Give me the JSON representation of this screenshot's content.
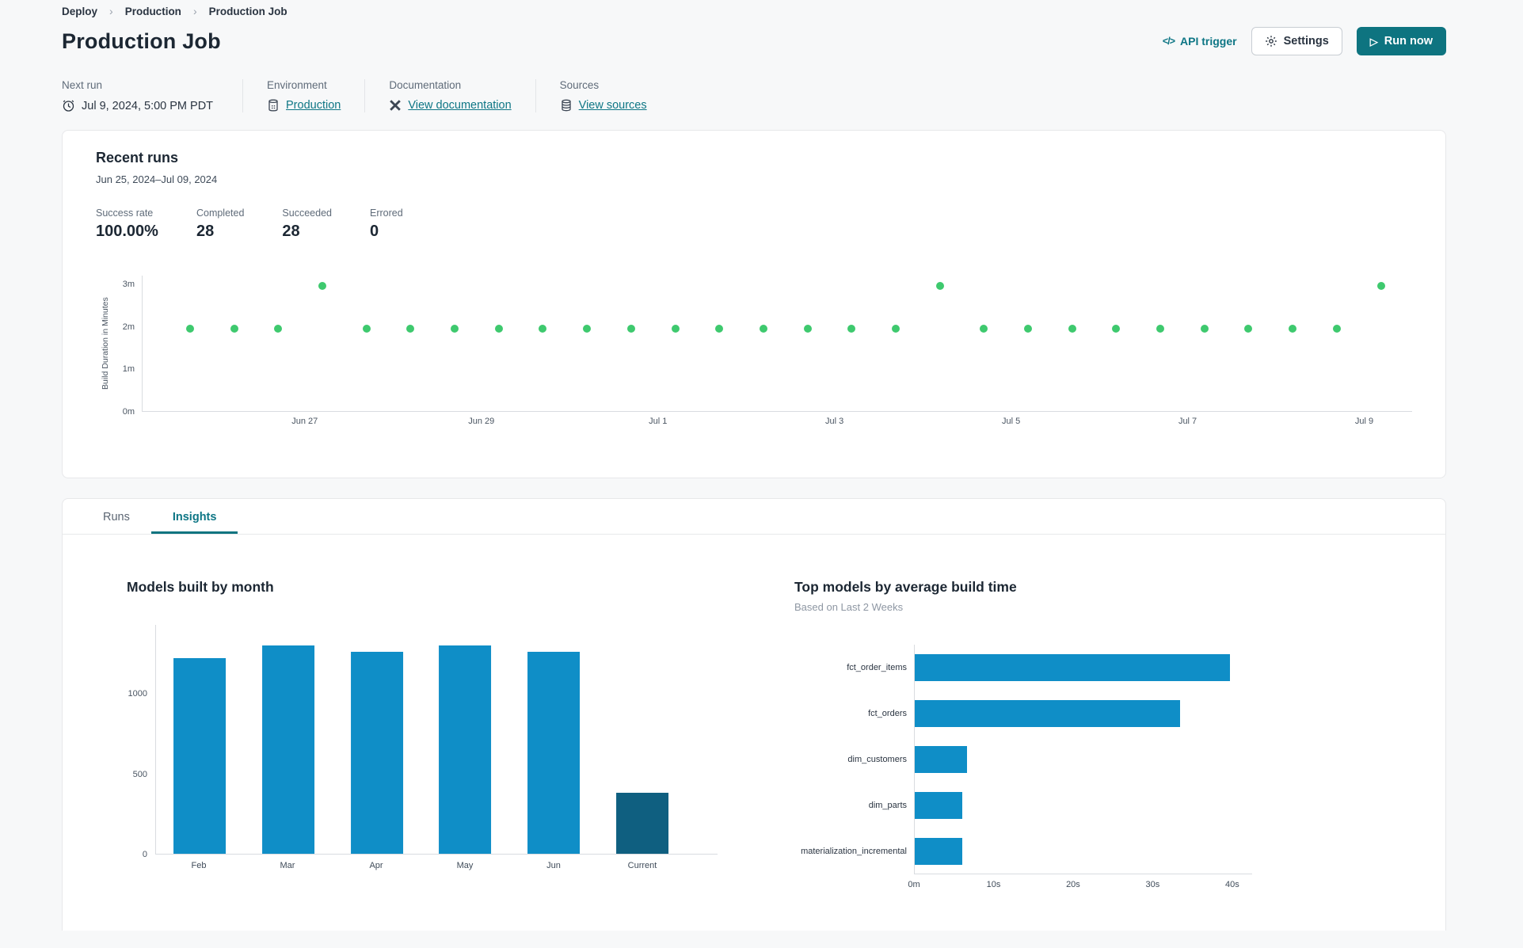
{
  "breadcrumb": {
    "items": [
      "Deploy",
      "Production",
      "Production Job"
    ],
    "separator": "›"
  },
  "header": {
    "title": "Production Job",
    "api_trigger_icon": "</>",
    "api_trigger_label": "API trigger",
    "settings_label": "Settings",
    "run_now_icon": "▷",
    "run_now_label": "Run now"
  },
  "info_bar": {
    "next_run_label": "Next run",
    "next_run_value": "Jul 9, 2024, 5:00 PM PDT",
    "environment_label": "Environment",
    "environment_value": "Production",
    "documentation_label": "Documentation",
    "documentation_value": "View documentation",
    "sources_label": "Sources",
    "sources_value": "View sources"
  },
  "recent_runs": {
    "title": "Recent runs",
    "date_range": "Jun 25, 2024–Jul 09, 2024",
    "stats": [
      {
        "label": "Success rate",
        "value": "100.00%"
      },
      {
        "label": "Completed",
        "value": "28"
      },
      {
        "label": "Succeeded",
        "value": "28"
      },
      {
        "label": "Errored",
        "value": "0"
      }
    ]
  },
  "tabs": {
    "runs": "Runs",
    "insights": "Insights"
  },
  "colors": {
    "accent_teal": "#0E7480",
    "link_teal": "#0E7685",
    "success_green": "#3EC96E",
    "bar_blue": "#0F8EC7",
    "bar_dark": "#0F5F80"
  },
  "chart_data": [
    {
      "type": "scatter",
      "name": "recent-runs-build-duration",
      "ylabel": "Build Duration in Minutes",
      "y_ticks": [
        "0m",
        "1m",
        "2m",
        "3m"
      ],
      "y_tick_values": [
        0,
        1,
        2,
        3
      ],
      "ylim": [
        0,
        3.2
      ],
      "x_ticks": [
        "Jun 27",
        "Jun 29",
        "Jul 1",
        "Jul 3",
        "Jul 5",
        "Jul 7",
        "Jul 9"
      ],
      "point_color": "#3EC96E",
      "runs_per_day": 2,
      "durations_minutes": [
        1.95,
        1.95,
        1.95,
        2.95,
        1.95,
        1.95,
        1.95,
        1.95,
        1.95,
        1.95,
        1.95,
        1.95,
        1.95,
        1.95,
        1.95,
        1.95,
        1.95,
        2.95,
        1.95,
        1.95,
        1.95,
        1.95,
        1.95,
        1.95,
        1.95,
        1.95,
        1.95,
        2.95
      ]
    },
    {
      "type": "bar",
      "title": "Models built by month",
      "categories": [
        "Feb",
        "Mar",
        "Apr",
        "May",
        "Jun",
        "Current"
      ],
      "values": [
        1220,
        1300,
        1260,
        1300,
        1260,
        380
      ],
      "y_ticks": [
        0,
        500,
        1000
      ],
      "ylim": [
        0,
        1430
      ],
      "bar_colors": [
        "#0F8EC7",
        "#0F8EC7",
        "#0F8EC7",
        "#0F8EC7",
        "#0F8EC7",
        "#0F5F80"
      ]
    },
    {
      "type": "bar-horizontal",
      "title": "Top models by average build time",
      "subtitle": "Based on Last 2 Weeks",
      "categories": [
        "fct_order_items",
        "fct_orders",
        "dim_customers",
        "dim_parts",
        "materialization_incremental"
      ],
      "values_seconds": [
        39.7,
        33.4,
        6.6,
        6.0,
        6.0
      ],
      "x_ticks": [
        "0m",
        "10s",
        "20s",
        "30s",
        "40s"
      ],
      "x_tick_values": [
        0,
        10,
        20,
        30,
        40
      ],
      "xlim": [
        0,
        42.5
      ],
      "bar_color": "#0F8EC7"
    }
  ]
}
